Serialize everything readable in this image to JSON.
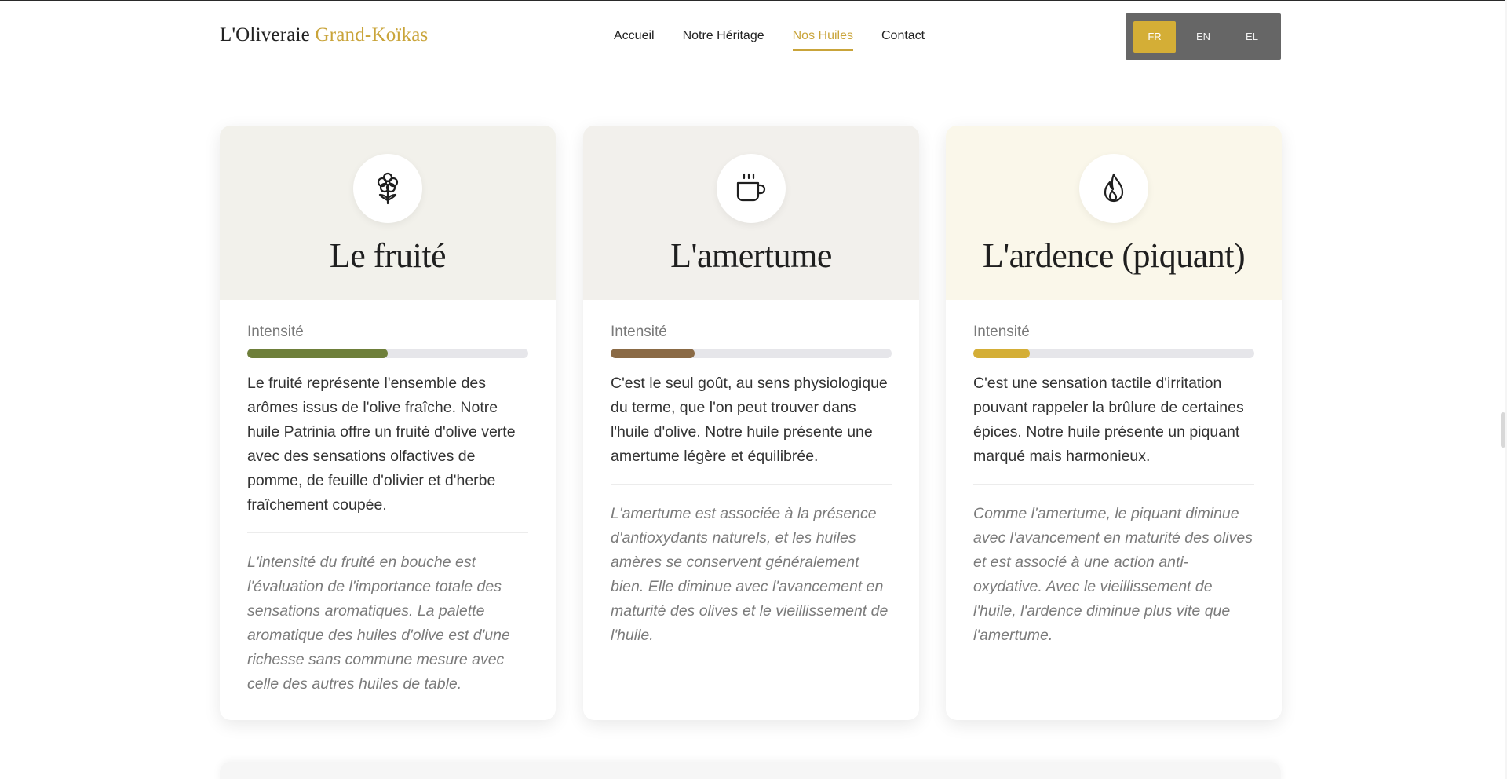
{
  "header": {
    "logo_main": "L'Oliveraie ",
    "logo_accent": "Grand-Koïkas",
    "nav": [
      {
        "label": "Accueil"
      },
      {
        "label": "Notre Héritage"
      },
      {
        "label": "Nos Huiles"
      },
      {
        "label": "Contact"
      }
    ],
    "active_nav": "Nos Huiles",
    "languages": [
      "FR",
      "EN",
      "EL"
    ],
    "active_language": "FR"
  },
  "cards": [
    {
      "icon": "flower-icon",
      "title": "Le fruité",
      "intensity_label": "Intensité",
      "intensity": 0.5,
      "bar_color": "#6e7f3a",
      "head_bg": "#f2f1eb",
      "description": "Le fruité représente l'ensemble des arômes issus de l'olive fraîche. Notre huile Patrinia offre un fruité d'olive verte avec des sensations olfactives de pomme, de feuille d'olivier et d'herbe fraîchement coupée.",
      "note": "L'intensité du fruité en bouche est l'évaluation de l'importance totale des sensations aromatiques. La palette aromatique des huiles d'olive est d'une richesse sans commune mesure avec celle des autres huiles de table."
    },
    {
      "icon": "coffee-cup-icon",
      "title": "L'amertume",
      "intensity_label": "Intensité",
      "intensity": 0.3,
      "bar_color": "#8a6a45",
      "head_bg": "#f2f0ec",
      "description": "C'est le seul goût, au sens physiologique du terme, que l'on peut trouver dans l'huile d'olive. Notre huile présente une amertume légère et équilibrée.",
      "note": "L'amertume est associée à la présence d'antioxydants naturels, et les huiles amères se conservent généralement bien. Elle diminue avec l'avancement en maturité des olives et le vieillissement de l'huile."
    },
    {
      "icon": "flame-icon",
      "title": "L'ardence (piquant)",
      "intensity_label": "Intensité",
      "intensity": 0.2,
      "bar_color": "#d4ae36",
      "head_bg": "#faf7ea",
      "description": "C'est une sensation tactile d'irritation pouvant rappeler la brûlure de certaines épices. Notre huile présente un piquant marqué mais harmonieux.",
      "note": "Comme l'amertume, le piquant diminue avec l'avancement en maturité des olives et est associé à une action anti-oxydative. Avec le vieillissement de l'huile, l'ardence diminue plus vite que l'amertume."
    }
  ]
}
